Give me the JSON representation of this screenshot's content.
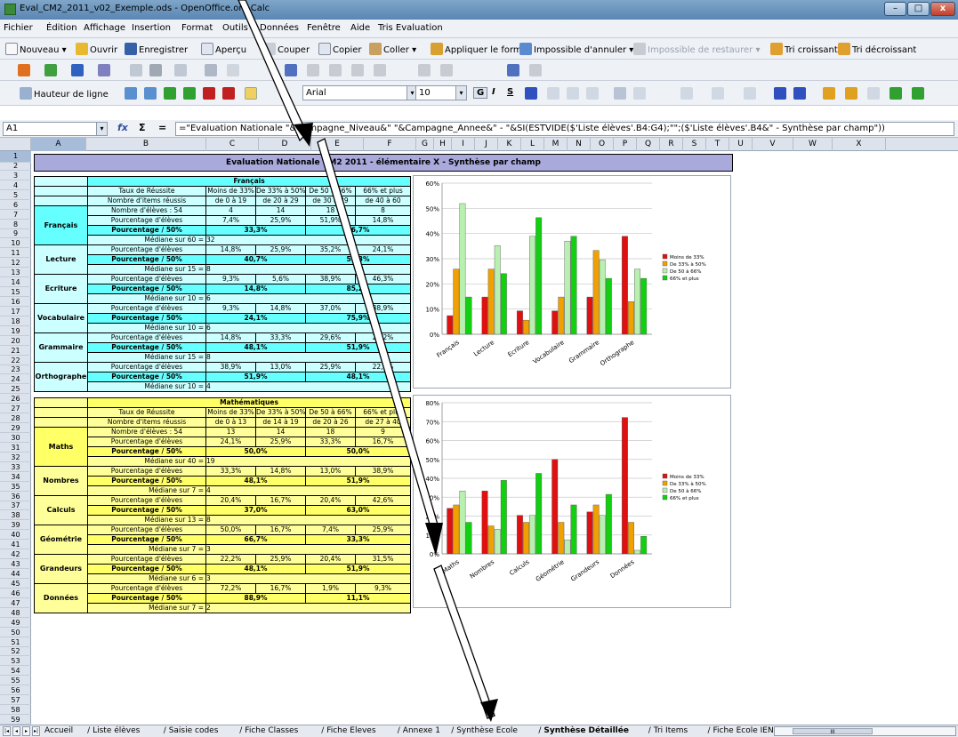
{
  "window": {
    "title": "Eval_CM2_2011_v02_Exemple.ods - OpenOffice.org Calc",
    "minimize": "–",
    "maximize": "□",
    "close": "x"
  },
  "menu": [
    "Fichier",
    "Édition",
    "Affichage",
    "Insertion",
    "Format",
    "Outils",
    "Données",
    "Fenêtre",
    "Aide",
    "Tris Evaluation"
  ],
  "toolbar1": {
    "new": "Nouveau",
    "open": "Ouvrir",
    "save": "Enregistrer",
    "preview": "Aperçu",
    "cut": "Couper",
    "copy": "Copier",
    "paste": "Coller",
    "apply_format": "Appliquer le format",
    "undo": "Impossible d'annuler",
    "redo": "Impossible de restaurer",
    "sort_asc": "Tri croissant",
    "sort_desc": "Tri décroissant"
  },
  "toolbar3": {
    "row_height": "Hauteur de ligne",
    "font": "Arial",
    "size": "10",
    "bold": "G",
    "italic": "I",
    "underline": "S"
  },
  "formula": {
    "cell": "A1",
    "fx": "fx",
    "sum": "Σ",
    "eq": "=",
    "value": "=\"Evaluation Nationale \"&Campagne_Niveau&\" \"&Campagne_Annee&\" - \"&SI(ESTVIDE($'Liste élèves'.B4:G4);\"\";($'Liste élèves'.B4&\" - Synthèse par champ\"))"
  },
  "columns": [
    "A",
    "B",
    "C",
    "D",
    "E",
    "F",
    "G",
    "H",
    "I",
    "J",
    "K",
    "L",
    "M",
    "N",
    "O",
    "P",
    "Q",
    "R",
    "S",
    "T",
    "U",
    "V",
    "W",
    "X"
  ],
  "rows": [
    "1",
    "2",
    "3",
    "4",
    "5",
    "6",
    "7",
    "8",
    "9",
    "10",
    "11",
    "12",
    "13",
    "14",
    "15",
    "16",
    "17",
    "18",
    "19",
    "20",
    "21",
    "22",
    "23",
    "24",
    "25",
    "26",
    "27",
    "28",
    "29",
    "30",
    "31",
    "32",
    "33",
    "34",
    "35",
    "36",
    "37",
    "38",
    "39",
    "40",
    "41",
    "42",
    "43",
    "44",
    "45",
    "46",
    "47",
    "48",
    "49",
    "50",
    "51",
    "52",
    "53",
    "54",
    "55",
    "56",
    "57",
    "58",
    "59"
  ],
  "banner": "Evaluation Nationale CM2 2011 - élémentaire X - Synthèse par champ",
  "francais": {
    "title": "Français",
    "header": [
      "Taux de Réussite",
      "Moins de 33%",
      "De 33% à 50%",
      "De 50 à 66%",
      "66% et plus"
    ],
    "items": [
      "Nombre d'items réussis",
      "de 0 à 19",
      "de 20 à 29",
      "de 30 à 39",
      "de 40 à 60"
    ],
    "main_label": "Français",
    "nb": [
      "Nombre d'élèves : 54",
      "4",
      "14",
      "18",
      "8"
    ],
    "pct": [
      "Pourcentage d'élèves",
      "7,4%",
      "25,9%",
      "51,9%",
      "14,8%"
    ],
    "p50": [
      "Pourcentage / 50%",
      "33,3%",
      "66,7%"
    ],
    "median": [
      "Médiane sur 60 =",
      "32"
    ],
    "subs": [
      {
        "name": "Lecture",
        "pct": [
          "14,8%",
          "25,9%",
          "35,2%",
          "24,1%"
        ],
        "p50": [
          "40,7%",
          "59,3%"
        ],
        "median": [
          "Médiane sur 15 =",
          "8"
        ]
      },
      {
        "name": "Ecriture",
        "pct": [
          "9,3%",
          "5,6%",
          "38,9%",
          "46,3%"
        ],
        "p50": [
          "14,8%",
          "85,2%"
        ],
        "median": [
          "Médiane sur 10 =",
          "6"
        ]
      },
      {
        "name": "Vocabulaire",
        "pct": [
          "9,3%",
          "14,8%",
          "37,0%",
          "38,9%"
        ],
        "p50": [
          "24,1%",
          "75,9%"
        ],
        "median": [
          "Médiane sur 10 =",
          "6"
        ]
      },
      {
        "name": "Grammaire",
        "pct": [
          "14,8%",
          "33,3%",
          "29,6%",
          "22,2%"
        ],
        "p50": [
          "48,1%",
          "51,9%"
        ],
        "median": [
          "Médiane sur 15 =",
          "8"
        ]
      },
      {
        "name": "Orthographe",
        "pct": [
          "38,9%",
          "13,0%",
          "25,9%",
          "22,2%"
        ],
        "p50": [
          "51,9%",
          "48,1%"
        ],
        "median": [
          "Médiane sur 10 =",
          "4"
        ]
      }
    ]
  },
  "maths": {
    "title": "Mathématiques",
    "header": [
      "Taux de Réussite",
      "Moins de 33%",
      "De 33% à 50%",
      "De 50 à 66%",
      "66% et plus"
    ],
    "items": [
      "Nombre d'items réussis",
      "de 0 à 13",
      "de 14 à 19",
      "de 20 à 26",
      "de 27 à 40"
    ],
    "main_label": "Maths",
    "nb": [
      "Nombre d'élèves : 54",
      "13",
      "14",
      "18",
      "9"
    ],
    "pct": [
      "Pourcentage d'élèves",
      "24,1%",
      "25,9%",
      "33,3%",
      "16,7%"
    ],
    "p50": [
      "Pourcentage / 50%",
      "50,0%",
      "50,0%"
    ],
    "median": [
      "Médiane sur 40 =",
      "19"
    ],
    "subs": [
      {
        "name": "Nombres",
        "pct": [
          "33,3%",
          "14,8%",
          "13,0%",
          "38,9%"
        ],
        "p50": [
          "48,1%",
          "51,9%"
        ],
        "median": [
          "Médiane sur 7 =",
          "4"
        ]
      },
      {
        "name": "Calculs",
        "pct": [
          "20,4%",
          "16,7%",
          "20,4%",
          "42,6%"
        ],
        "p50": [
          "37,0%",
          "63,0%"
        ],
        "median": [
          "Médiane sur 13 =",
          "8"
        ]
      },
      {
        "name": "Géométrie",
        "pct": [
          "50,0%",
          "16,7%",
          "7,4%",
          "25,9%"
        ],
        "p50": [
          "66,7%",
          "33,3%"
        ],
        "median": [
          "Médiane sur 7 =",
          "3"
        ]
      },
      {
        "name": "Grandeurs",
        "pct": [
          "22,2%",
          "25,9%",
          "20,4%",
          "31,5%"
        ],
        "p50": [
          "48,1%",
          "51,9%"
        ],
        "median": [
          "Médiane sur 6 =",
          "3"
        ]
      },
      {
        "name": "Données",
        "pct": [
          "72,2%",
          "16,7%",
          "1,9%",
          "9,3%"
        ],
        "p50": [
          "88,9%",
          "11,1%"
        ],
        "median": [
          "Médiane sur 7 =",
          "2"
        ]
      }
    ]
  },
  "chart_data": [
    {
      "type": "bar",
      "categories": [
        "Français",
        "Lecture",
        "Ecriture",
        "Vocabulaire",
        "Grammaire",
        "Orthographe"
      ],
      "series": [
        {
          "name": "Moins de 33%",
          "color": "#e01010",
          "values": [
            7.4,
            14.8,
            9.3,
            9.3,
            14.8,
            38.9
          ]
        },
        {
          "name": "De 33% à 50%",
          "color": "#f0a000",
          "values": [
            25.9,
            25.9,
            5.6,
            14.8,
            33.3,
            13.0
          ]
        },
        {
          "name": "De 50 à 66%",
          "color": "#b8f0b0",
          "values": [
            51.9,
            35.2,
            38.9,
            37.0,
            29.6,
            25.9
          ]
        },
        {
          "name": "66% et plus",
          "color": "#10d010",
          "values": [
            14.8,
            24.1,
            46.3,
            38.9,
            22.2,
            22.2
          ]
        }
      ],
      "ylim": [
        0,
        60
      ],
      "yticks": [
        "0%",
        "10%",
        "20%",
        "30%",
        "40%",
        "50%",
        "60%"
      ],
      "grid": true,
      "legend": "right"
    },
    {
      "type": "bar",
      "categories": [
        "Maths",
        "Nombres",
        "Calculs",
        "Géométrie",
        "Grandeurs",
        "Données"
      ],
      "series": [
        {
          "name": "Moins de 33%",
          "color": "#e01010",
          "values": [
            24.1,
            33.3,
            20.4,
            50.0,
            22.2,
            72.2
          ]
        },
        {
          "name": "De 33% à 50%",
          "color": "#f0a000",
          "values": [
            25.9,
            14.8,
            16.7,
            16.7,
            25.9,
            16.7
          ]
        },
        {
          "name": "De 50 à 66%",
          "color": "#b8f0b0",
          "values": [
            33.3,
            13.0,
            20.4,
            7.4,
            20.4,
            1.9
          ]
        },
        {
          "name": "66% et plus",
          "color": "#10d010",
          "values": [
            16.7,
            38.9,
            42.6,
            25.9,
            31.5,
            9.3
          ]
        }
      ],
      "ylim": [
        0,
        80
      ],
      "yticks": [
        "0%",
        "10%",
        "20%",
        "30%",
        "40%",
        "50%",
        "60%",
        "70%",
        "80%"
      ],
      "grid": true,
      "legend": "right"
    }
  ],
  "sheets": [
    "Accueil",
    "Liste élèves",
    "Saisie codes",
    "Fiche Classes",
    "Fiche Eleves",
    "Annexe 1",
    "Synthèse Ecole",
    "Synthèse Détaillée",
    "Tri Items",
    "Fiche Ecole IEN"
  ],
  "active_sheet": "Synthèse Détaillée",
  "scroll": "III",
  "chart_legend_labels": [
    "Moins de 33%",
    "De 33% à 50%",
    "De 50 à 66%",
    "66% et plus"
  ]
}
